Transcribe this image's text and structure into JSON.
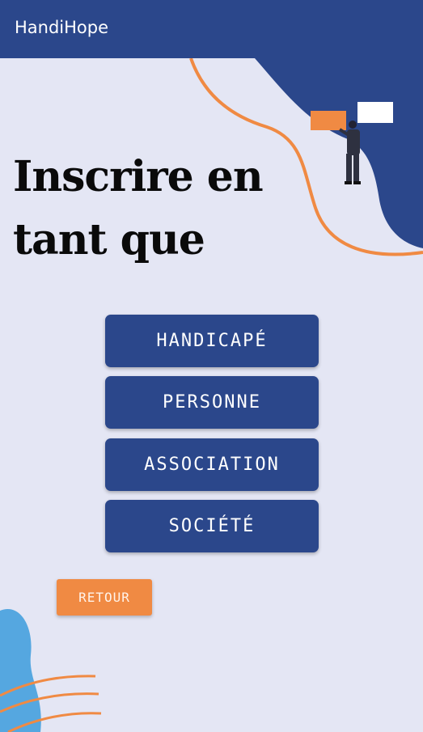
{
  "app_bar": {
    "title": "HandiHope"
  },
  "main": {
    "headline_line1": "Inscrire en",
    "headline_line2": "tant que",
    "options": [
      {
        "label": "HANDICAPÉ"
      },
      {
        "label": "PERSONNE"
      },
      {
        "label": "ASSOCIATION"
      },
      {
        "label": "SOCIÉTÉ"
      }
    ],
    "back_label": "RETOUR"
  },
  "colors": {
    "primary": "#2b478b",
    "accent": "#f08a43",
    "background": "#e4e6f4",
    "light_blue": "#55a7e0"
  }
}
